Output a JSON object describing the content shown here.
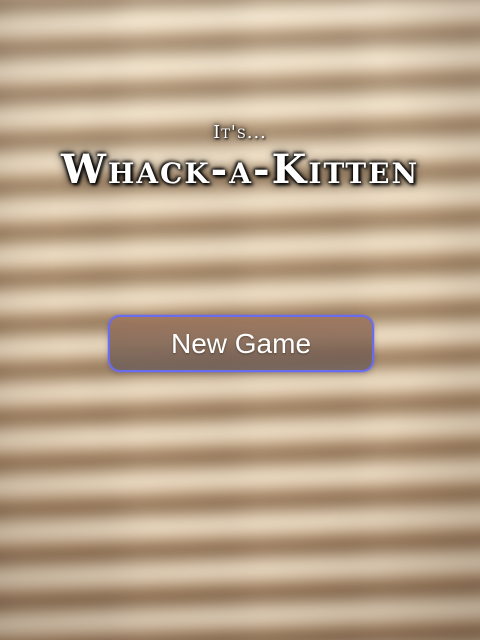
{
  "title_screen": {
    "pre_title": "It's...",
    "title": "Whack-a-Kitten"
  },
  "menu": {
    "new_game_label": "New Game"
  },
  "colors": {
    "button_border": "#6a6cf0",
    "title_text": "#ffffff"
  }
}
